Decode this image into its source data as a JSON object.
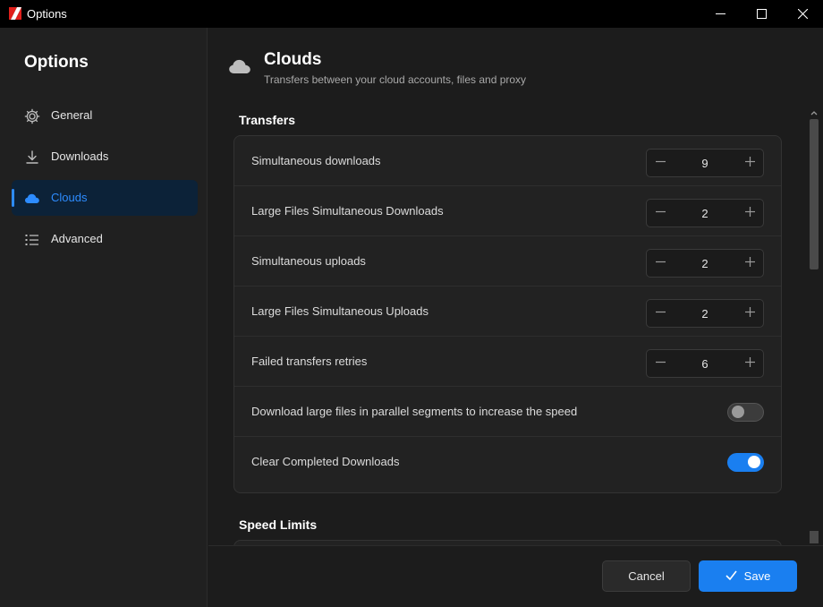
{
  "window": {
    "title": "Options",
    "logo_icon": "app-logo-icon",
    "controls": [
      "minimize-icon",
      "maximize-icon",
      "close-icon"
    ]
  },
  "sidebar": {
    "title": "Options",
    "items": [
      {
        "label": "General",
        "icon": "gear-icon",
        "active": false
      },
      {
        "label": "Downloads",
        "icon": "download-icon",
        "active": false
      },
      {
        "label": "Clouds",
        "icon": "cloud-icon",
        "active": true
      },
      {
        "label": "Advanced",
        "icon": "list-icon",
        "active": false
      }
    ]
  },
  "header": {
    "icon": "cloud-icon",
    "title": "Clouds",
    "subtitle": "Transfers between your cloud accounts, files and proxy"
  },
  "transfers": {
    "title": "Transfers",
    "rows": [
      {
        "label": "Simultaneous downloads",
        "type": "stepper",
        "value": "9"
      },
      {
        "label": "Large Files Simultaneous Downloads",
        "type": "stepper",
        "value": "2"
      },
      {
        "label": "Simultaneous uploads",
        "type": "stepper",
        "value": "2"
      },
      {
        "label": "Large Files Simultaneous Uploads",
        "type": "stepper",
        "value": "2"
      },
      {
        "label": "Failed transfers retries",
        "type": "stepper",
        "value": "6"
      },
      {
        "label": "Download large files in parallel segments to increase the speed",
        "type": "toggle",
        "on": false
      },
      {
        "label": "Clear Completed Downloads",
        "type": "toggle",
        "on": true
      }
    ]
  },
  "speed_limits": {
    "title": "Speed Limits"
  },
  "footer": {
    "cancel_label": "Cancel",
    "save_label": "Save"
  },
  "colors": {
    "accent": "#1a7ff0",
    "active_nav_bg": "#0c2238",
    "background": "#1c1c1c"
  }
}
